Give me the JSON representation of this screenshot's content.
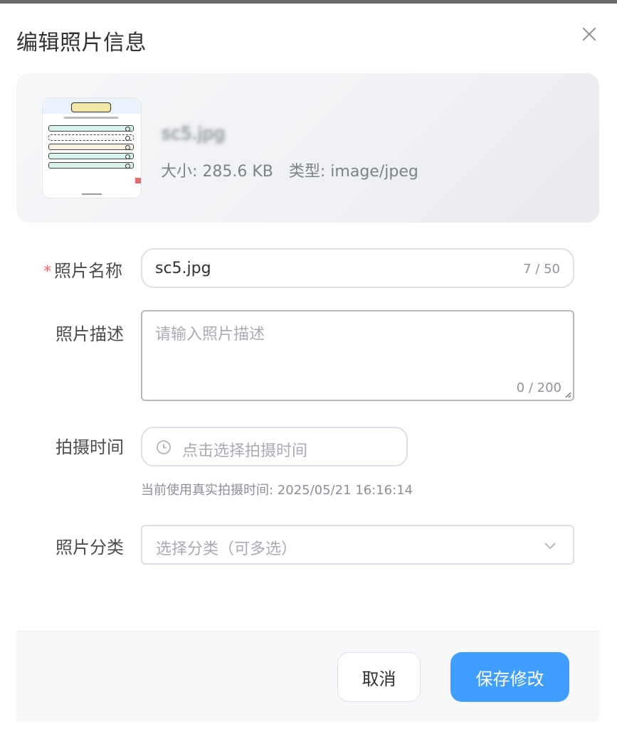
{
  "dialog": {
    "title": "编辑照片信息",
    "close_icon": "close-icon"
  },
  "preview": {
    "file_name": "sc5.jpg",
    "size_text": "大小: 285.6 KB",
    "type_text": "类型: image/jpeg"
  },
  "form": {
    "name": {
      "required_mark": "*",
      "label": "照片名称",
      "value": "sc5.jpg",
      "count": "7 / 50"
    },
    "description": {
      "label": "照片描述",
      "placeholder": "请输入照片描述",
      "count": "0 / 200"
    },
    "shoot_time": {
      "label": "拍摄时间",
      "placeholder": "点击选择拍摄时间",
      "icon": "clock-icon",
      "hint": "当前使用真实拍摄时间: 2025/05/21 16:16:14"
    },
    "category": {
      "label": "照片分类",
      "placeholder": "选择分类（可多选）",
      "icon": "chevron-down-icon"
    }
  },
  "footer": {
    "cancel_label": "取消",
    "save_label": "保存修改"
  },
  "colors": {
    "primary": "#409eff",
    "required": "#f56c6c"
  }
}
